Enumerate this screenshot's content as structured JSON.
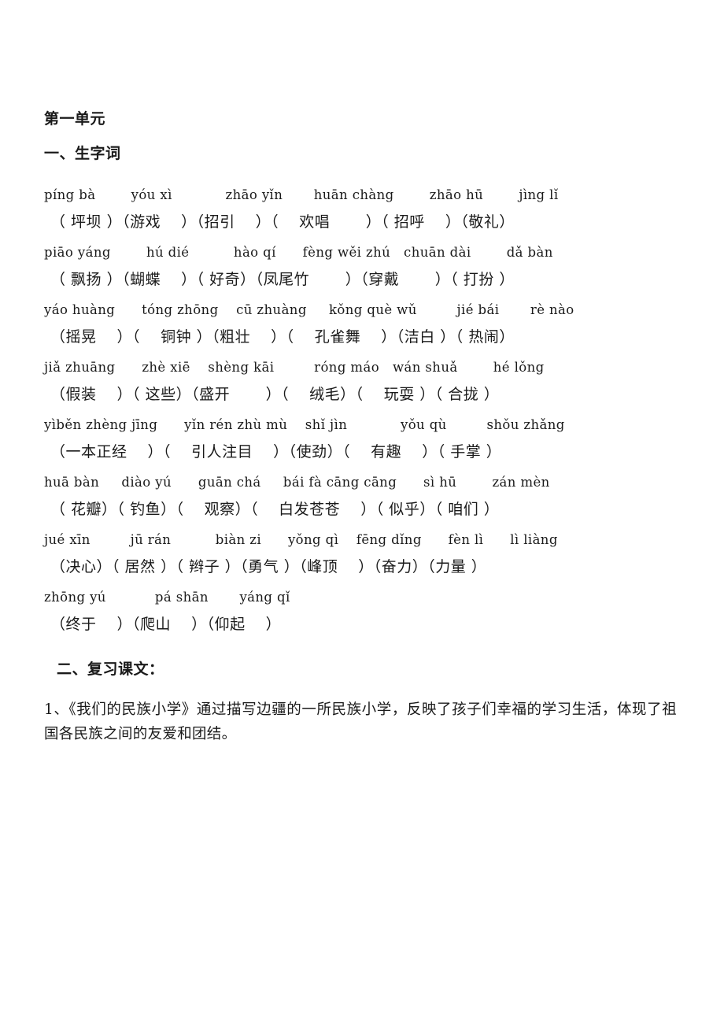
{
  "document": {
    "unit_title": "第一单元",
    "section_one_title": "一、生字词",
    "section_two_title": "二、复习课文："
  },
  "vocabulary_groups": [
    {
      "pinyin": "píng bà        yóu xì            zhāo yǐn       huān chàng        zhāo hū        jìng lǐ",
      "hanzi": "（ 坪坝 ）（游戏　 ）（招引　 ）（ 　欢唱　 　）（ 招呼　 ）（敬礼）"
    },
    {
      "pinyin": "piāo yáng        hú dié          hào qí      fèng wěi zhú   chuān dài        dǎ bàn",
      "hanzi": "（ 飘扬 ）（蝴蝶　 ）（ 好奇）（凤尾竹　　 ）（穿戴　　 ）（ 打扮 ）"
    },
    {
      "pinyin": "yáo huàng      tóng zhōng    cū zhuàng     kǒng què wǔ         jié bái       rè nào",
      "hanzi": "（摇晃　 ）（ 　铜钟 ）（粗壮　 ）（ 　孔雀舞　 ）（洁白 ）（ 热闹）"
    },
    {
      "pinyin": "jiǎ zhuāng      zhè xiē    shèng kāi         róng máo   wán shuǎ        hé lǒng",
      "hanzi": "（假装　 ）（ 这些）（盛开　　 ）（ 　绒毛）（ 　玩耍 ）（ 合拢 ）"
    },
    {
      "pinyin": "yìběn zhèng jīng      yǐn rén zhù mù    shǐ jìn            yǒu qù         shǒu zhǎng",
      "hanzi": "（一本正经　 ）（ 　引人注目　 ）（使劲）（ 　有趣　 ）（ 手掌 ）"
    },
    {
      "pinyin": "huā bàn     diào yú      guān chá     bái fà cāng cāng      sì hū        zán mèn",
      "hanzi": "（ 花瓣）（ 钓鱼）（ 　观察）（ 　白发苍苍　 ）（ 似乎）（ 咱们 ）"
    },
    {
      "pinyin": "jué xīn         jū rán          biàn zi      yǒng qì    fēng dǐng      fèn lì      lì liàng",
      "hanzi": "（决心）（ 居然 ）（ 辫子 ）（勇气 ）（峰顶　 ）（奋力）（力量 ）"
    },
    {
      "pinyin": "zhōng yú           pá shān       yáng qǐ",
      "hanzi": "（终于　 ）（爬山　 ）（仰起　 ）"
    }
  ],
  "review_items": [
    "1、《我们的民族小学》通过描写边疆的一所民族小学，反映了孩子们幸福的学习生活，体现了祖国各民族之间的友爱和团结。"
  ]
}
